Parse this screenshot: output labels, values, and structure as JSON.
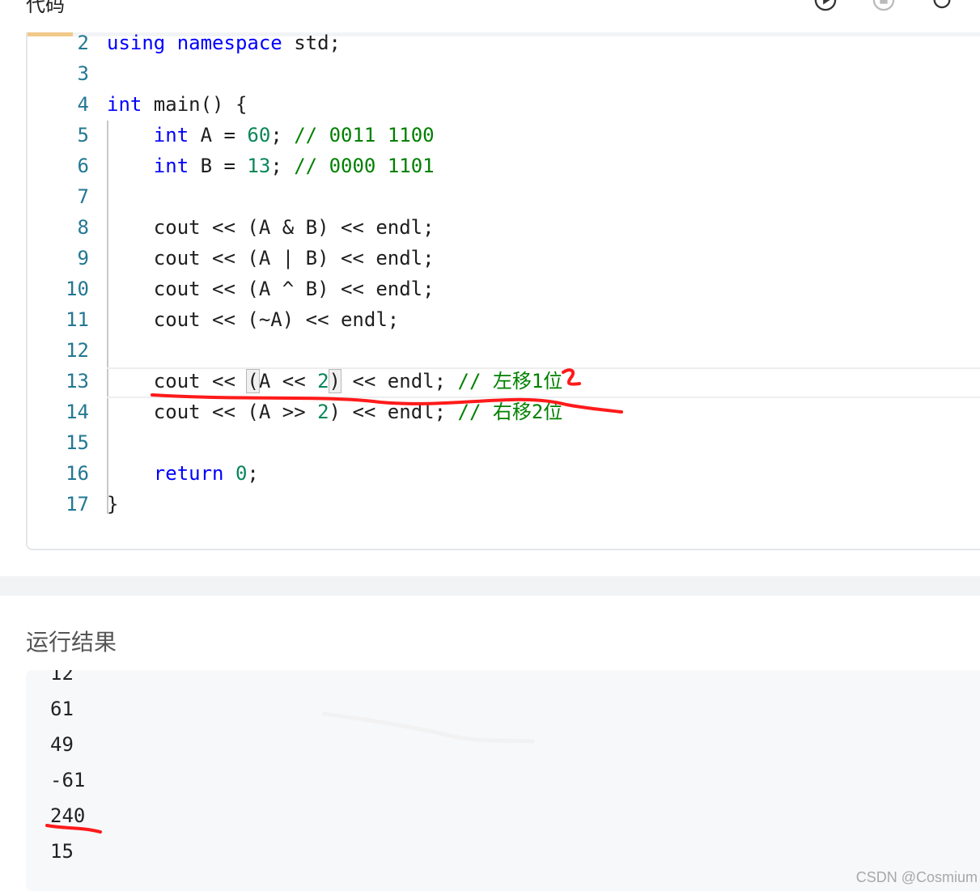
{
  "header": {
    "title": "代码"
  },
  "code": {
    "lines": [
      {
        "n": "2",
        "html": "<span class=\"kw\">using</span> <span class=\"kw\">namespace</span> std;"
      },
      {
        "n": "3",
        "html": ""
      },
      {
        "n": "4",
        "html": "<span class=\"kw\">int</span> main() {"
      },
      {
        "n": "5",
        "html": "    <span class=\"kw\">int</span> A = <span class=\"num\">60</span>; <span class=\"cm\">// 0011 1100</span>"
      },
      {
        "n": "6",
        "html": "    <span class=\"kw\">int</span> B = <span class=\"num\">13</span>; <span class=\"cm\">// 0000 1101</span>"
      },
      {
        "n": "7",
        "html": ""
      },
      {
        "n": "8",
        "html": "    cout << (A & B) << endl;"
      },
      {
        "n": "9",
        "html": "    cout << (A | B) << endl;"
      },
      {
        "n": "10",
        "html": "    cout << (A ^ B) << endl;"
      },
      {
        "n": "11",
        "html": "    cout << (~A) << endl;"
      },
      {
        "n": "12",
        "html": ""
      },
      {
        "n": "13",
        "html": "    cout << <span class=\"bracket\">(</span>A << <span class=\"num\">2</span><span class=\"bracket\">)</span> << endl; <span class=\"cm\">// 左移1位</span>"
      },
      {
        "n": "14",
        "html": "    cout << (A >> <span class=\"num\">2</span>) << endl; <span class=\"cm\">// 右移2位</span>"
      },
      {
        "n": "15",
        "html": ""
      },
      {
        "n": "16",
        "html": "    <span class=\"kw\">return</span> <span class=\"num\">0</span>;"
      },
      {
        "n": "17",
        "html": "}"
      }
    ]
  },
  "result": {
    "title": "运行结果",
    "output": [
      "12",
      "61",
      "49",
      "-61",
      "240",
      "15"
    ]
  },
  "watermark": "CSDN @Cosmium",
  "colors": {
    "keyword": "#0000ff",
    "number": "#098658",
    "comment": "#008000",
    "annotation": "#ff1a1a"
  }
}
